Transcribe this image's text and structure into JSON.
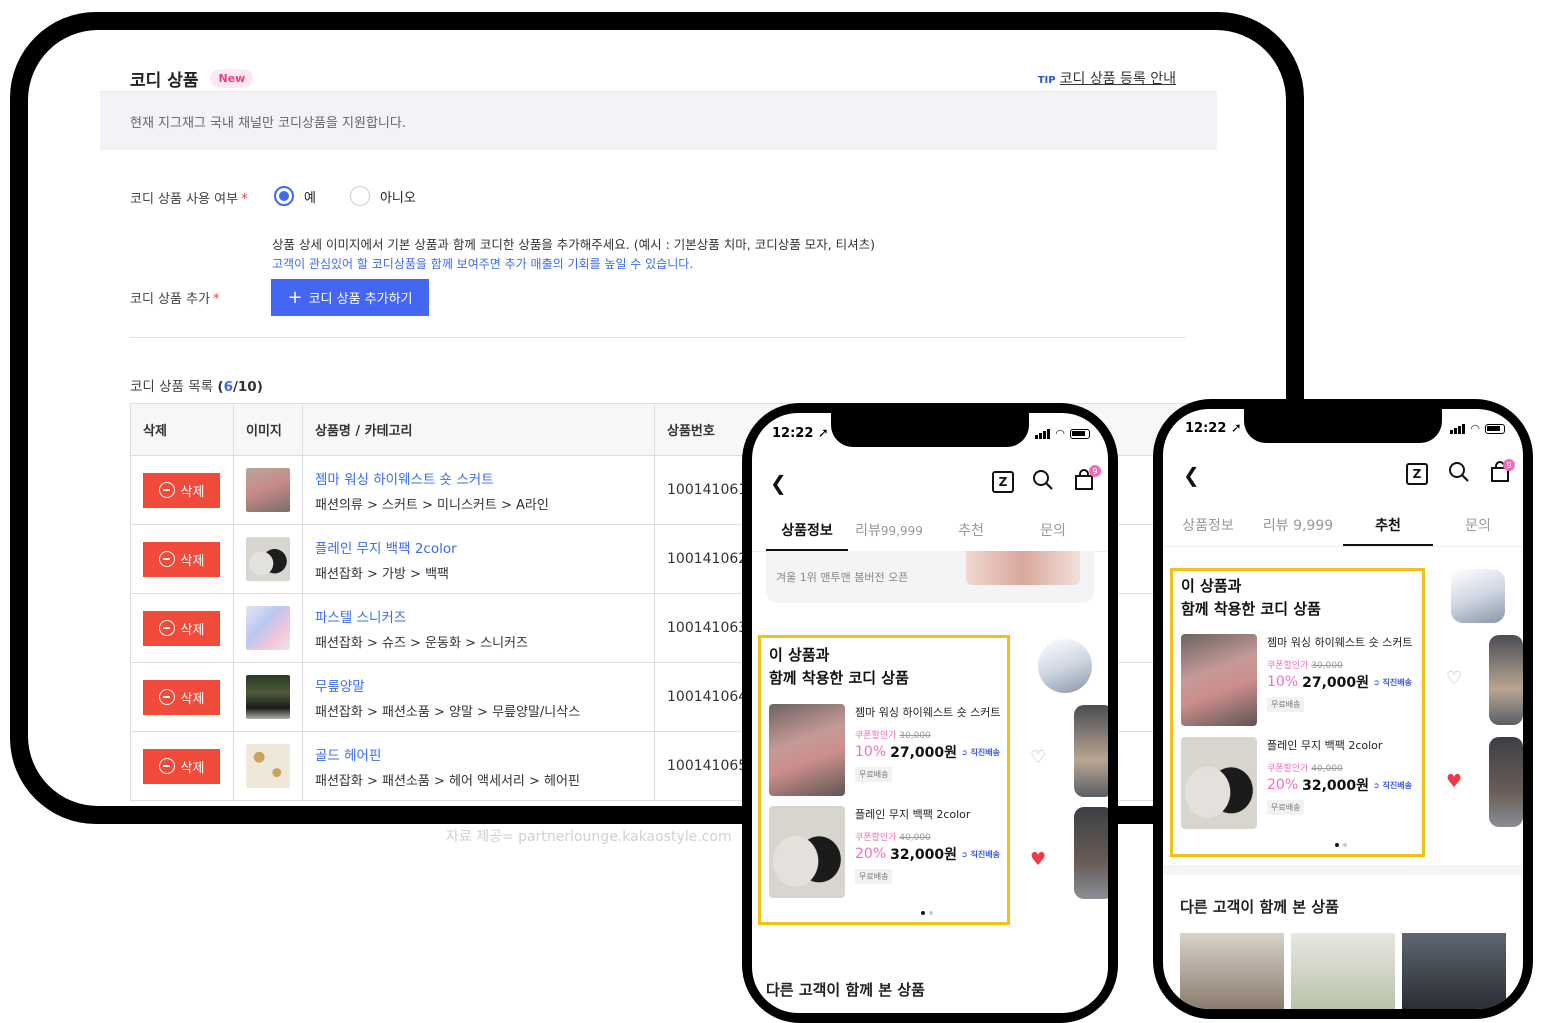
{
  "admin": {
    "title": "코디 상품",
    "new_badge": "New",
    "tip_label": "TIP",
    "tip_link": "코디 상품 등록 안내",
    "notice": "현재 지그재그 국내 채널만 코디상품을 지원합니다.",
    "use_label": "코디 상품 사용 여부",
    "required_mark": "*",
    "radio_yes": "예",
    "radio_no": "아니오",
    "selected": "예",
    "desc_line1": "상품 상세 이미지에서 기본 상품과 함께 코디한 상품을 추가해주세요. (예시 : 기본상품 치마, 코디상품 모자, 티셔츠)",
    "desc_line2": "고객이 관심있어 할 코디상품을 함께 보여주면 추가 매출의 기회를 높일 수 있습니다.",
    "add_label": "코디 상품 추가",
    "add_button": "코디 상품 추가하기",
    "list_title": "코디 상품 목록",
    "list_count_current": "6",
    "list_count_max": "/10",
    "columns": [
      "삭제",
      "이미지",
      "상품명 / 카테고리",
      "상품번호"
    ],
    "delete_label": "삭제",
    "rows": [
      {
        "name": "젬마 워싱 하이웨스트 숏 스커트",
        "category": "패션의류 > 스커트 > 미니스커트 > A라인",
        "id": "100141061"
      },
      {
        "name": "플레인 무지 백팩 2color",
        "category": "패션잡화 > 가방 > 백팩",
        "id": "100141062"
      },
      {
        "name": "파스텔 스니커즈",
        "category": "패션잡화 > 슈즈 > 운동화 > 스니커즈",
        "id": "100141063"
      },
      {
        "name": "무릎양말",
        "category": "패션잡화 > 패션소품 > 양말 > 무릎양말/니삭스",
        "id": "100141064"
      },
      {
        "name": "골드 헤어핀",
        "category": "패션잡화 > 패션소품 > 헤어 액세서리 > 헤어핀",
        "id": "100141065"
      }
    ],
    "credit": "자료 제공= partnerlounge.kakaostyle.com"
  },
  "phone1": {
    "time": "12:22",
    "bag_count": "9",
    "tabs": [
      {
        "label": "상품정보",
        "active": true
      },
      {
        "label": "리뷰",
        "num": "99,999",
        "active": false
      },
      {
        "label": "추천",
        "active": false
      },
      {
        "label": "문의",
        "active": false
      }
    ],
    "banner_text": "겨울 1위 맨투맨 봄버전 오픈",
    "box_title_1": "이 상품과",
    "box_title_2": "함께 착용한 코디 상품",
    "others_title": "다른 고객이 함께 본 상품"
  },
  "phone2": {
    "time": "12:22",
    "bag_count": "9",
    "tabs": [
      {
        "label": "상품정보",
        "active": false
      },
      {
        "label": "리뷰",
        "num": "9,999",
        "active": false
      },
      {
        "label": "추천",
        "active": true
      },
      {
        "label": "문의",
        "active": false
      }
    ],
    "box_title_1": "이 상품과",
    "box_title_2": "함께 착용한 코디 상품",
    "others_title": "다른 고객이 함께 본 상품"
  },
  "coordi_items": [
    {
      "name": "젬마 워싱 하이웨스트 숏 스커트",
      "coupon_label": "쿠폰할인가",
      "original": "30,000",
      "pct": "10%",
      "price": "27,000원",
      "ship": "직진배송",
      "free": "무료배송"
    },
    {
      "name": "플레인 무지 백팩 2color",
      "coupon_label": "쿠폰할인가",
      "original": "40,000",
      "pct": "20%",
      "price": "32,000원",
      "ship": "직진배송",
      "free": "무료배송"
    }
  ],
  "colors": {
    "accent_blue": "#4467f3",
    "delete_red": "#f04a3a",
    "highlight_yellow": "#f3c21a",
    "pink": "#f06fbf"
  }
}
